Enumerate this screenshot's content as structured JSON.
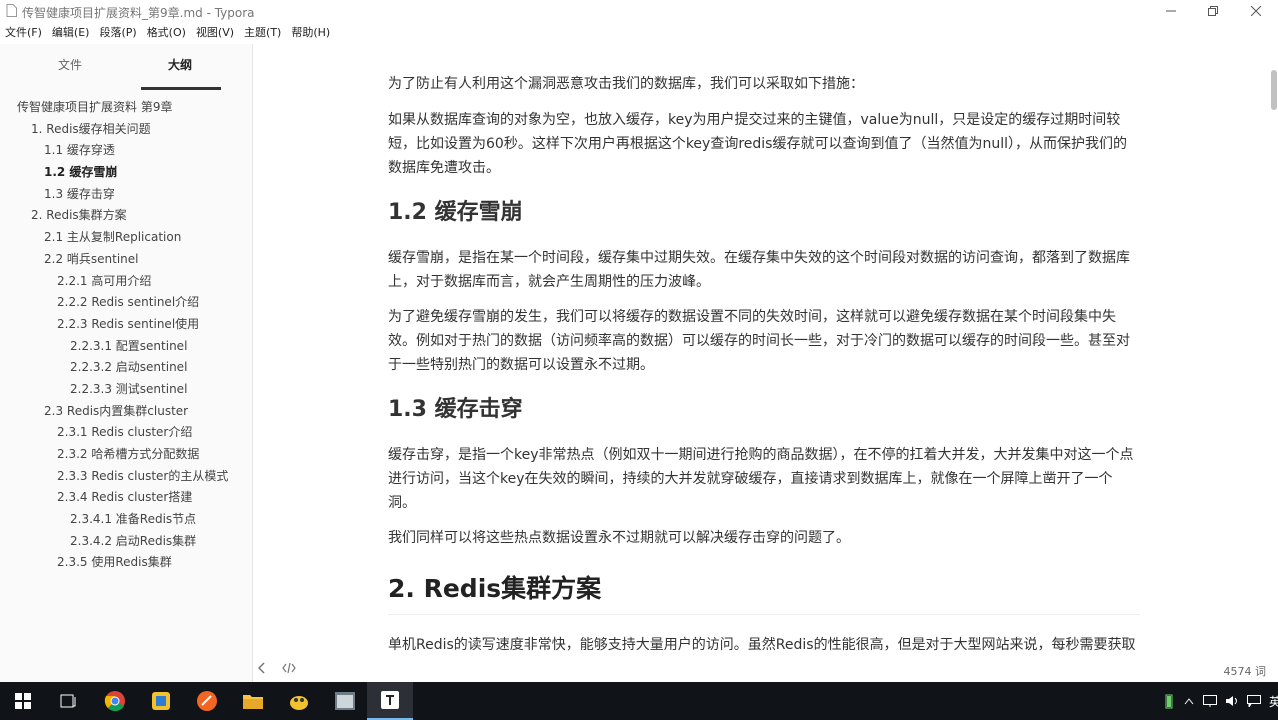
{
  "window": {
    "title": "传智健康项目扩展资料_第9章.md - Typora",
    "minimize_icon": "minimize-icon",
    "maximize_icon": "restore-icon",
    "close_icon": "close-icon"
  },
  "menubar": [
    "文件(F)",
    "编辑(E)",
    "段落(P)",
    "格式(O)",
    "视图(V)",
    "主题(T)",
    "帮助(H)"
  ],
  "sidebar": {
    "tabs": [
      "文件",
      "大纲"
    ],
    "active_tab": "大纲",
    "outline": [
      {
        "label": "传智健康项目扩展资料 第9章",
        "level": 0
      },
      {
        "label": "1. Redis缓存相关问题",
        "level": 1
      },
      {
        "label": "1.1 缓存穿透",
        "level": 2
      },
      {
        "label": "1.2 缓存雪崩",
        "level": 2,
        "active": true
      },
      {
        "label": "1.3 缓存击穿",
        "level": 2
      },
      {
        "label": "2. Redis集群方案",
        "level": 1
      },
      {
        "label": "2.1 主从复制Replication",
        "level": 2
      },
      {
        "label": "2.2 哨兵sentinel",
        "level": 2
      },
      {
        "label": "2.2.1 高可用介绍",
        "level": 3
      },
      {
        "label": "2.2.2 Redis sentinel介绍",
        "level": 3
      },
      {
        "label": "2.2.3 Redis sentinel使用",
        "level": 3
      },
      {
        "label": "2.2.3.1 配置sentinel",
        "level": 4
      },
      {
        "label": "2.2.3.2 启动sentinel",
        "level": 4
      },
      {
        "label": "2.2.3.3 测试sentinel",
        "level": 4
      },
      {
        "label": "2.3 Redis内置集群cluster",
        "level": 2
      },
      {
        "label": "2.3.1 Redis cluster介绍",
        "level": 3
      },
      {
        "label": "2.3.2 哈希槽方式分配数据",
        "level": 3
      },
      {
        "label": "2.3.3 Redis cluster的主从模式",
        "level": 3
      },
      {
        "label": "2.3.4 Redis cluster搭建",
        "level": 3
      },
      {
        "label": "2.3.4.1 准备Redis节点",
        "level": 4
      },
      {
        "label": "2.3.4.2 启动Redis集群",
        "level": 4
      },
      {
        "label": "2.3.5 使用Redis集群",
        "level": 3
      }
    ]
  },
  "document": [
    {
      "type": "p",
      "text": "为了防止有人利用这个漏洞恶意攻击我们的数据库，我们可以采取如下措施："
    },
    {
      "type": "p",
      "text": "如果从数据库查询的对象为空，也放入缓存，key为用户提交过来的主键值，value为null，只是设定的缓存过期时间较短，比如设置为60秒。这样下次用户再根据这个key查询redis缓存就可以查询到值了（当然值为null），从而保护我们的数据库免遭攻击。"
    },
    {
      "type": "h2",
      "text": "1.2 缓存雪崩"
    },
    {
      "type": "p",
      "text": "缓存雪崩，是指在某一个时间段，缓存集中过期失效。在缓存集中失效的这个时间段对数据的访问查询，都落到了数据库上，对于数据库而言，就会产生周期性的压力波峰。"
    },
    {
      "type": "p",
      "text": "为了避免缓存雪崩的发生，我们可以将缓存的数据设置不同的失效时间，这样就可以避免缓存数据在某个时间段集中失效。例如对于热门的数据（访问频率高的数据）可以缓存的时间长一些，对于冷门的数据可以缓存的时间段一些。甚至对于一些特别热门的数据可以设置永不过期。"
    },
    {
      "type": "h2",
      "text": "1.3 缓存击穿"
    },
    {
      "type": "p",
      "text": "缓存击穿，是指一个key非常热点（例如双十一期间进行抢购的商品数据），在不停的扛着大并发，大并发集中对这一个点进行访问，当这个key在失效的瞬间，持续的大并发就穿破缓存，直接请求到数据库上，就像在一个屏障上凿开了一个洞。"
    },
    {
      "type": "p",
      "text": "我们同样可以将这些热点数据设置永不过期就可以解决缓存击穿的问题了。"
    },
    {
      "type": "h1",
      "text": "2. Redis集群方案"
    },
    {
      "type": "p",
      "text": "单机Redis的读写速度非常快，能够支持大量用户的访问。虽然Redis的性能很高，但是对于大型网站来说，每秒需要获取的数据远远超过单台redis服务所能承受的压力，所以我们迫切需要一种方案能够解决单台Redis服务性能"
    }
  ],
  "statusbar": {
    "back_icon": "chevron-left-icon",
    "source_icon": "code-icon",
    "wordcount": "4574 词"
  },
  "taskbar": {
    "tray_text": "英"
  }
}
